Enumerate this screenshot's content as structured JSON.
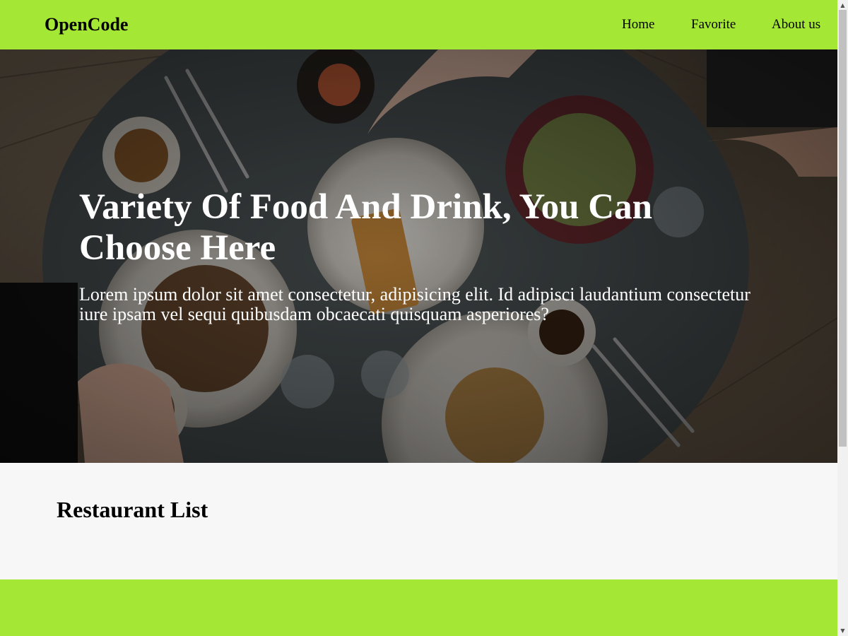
{
  "header": {
    "brand": "OpenCode",
    "nav": [
      "Home",
      "Favorite",
      "About us"
    ],
    "background_color": "#a4e835"
  },
  "hero": {
    "title": "Variety Of Food And Drink, You Can Choose Here",
    "text": "Lorem ipsum dolor sit amet consectetur, adipisicing elit. Id adipisci laudantium consectetur iure ipsam vel sequi quibusdam obcaecati quisquam asperiores?",
    "background_image": "overhead photo of a dining table with plates of food, waffles, coffee cups and hands"
  },
  "restaurant_list": {
    "title": "Restaurant List",
    "background_color": "#f7f7f7"
  },
  "footer": {
    "background_color": "#a4e835"
  },
  "scrollbar": {
    "up_icon": "triangle-up",
    "down_icon": "triangle-down"
  }
}
